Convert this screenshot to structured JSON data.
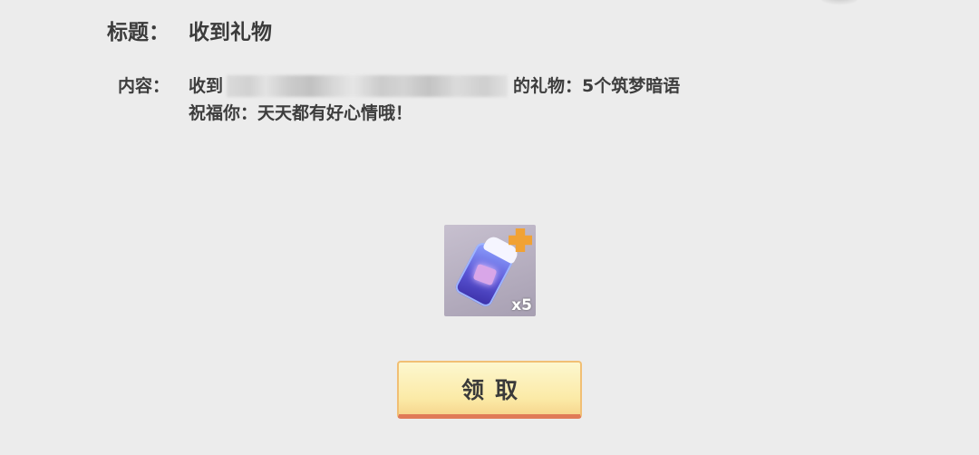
{
  "mail": {
    "title_label": "标题：",
    "title_value": "收到礼物",
    "content_label": "内容：",
    "content_prefix": "收到",
    "content_suffix": "的礼物：5个筑梦暗语",
    "content_line2": "祝福你：天天都有好心情哦！"
  },
  "gift": {
    "icon_name": "dream-whisper-card-icon",
    "quantity": "x5"
  },
  "button": {
    "claim_label": "领取"
  }
}
